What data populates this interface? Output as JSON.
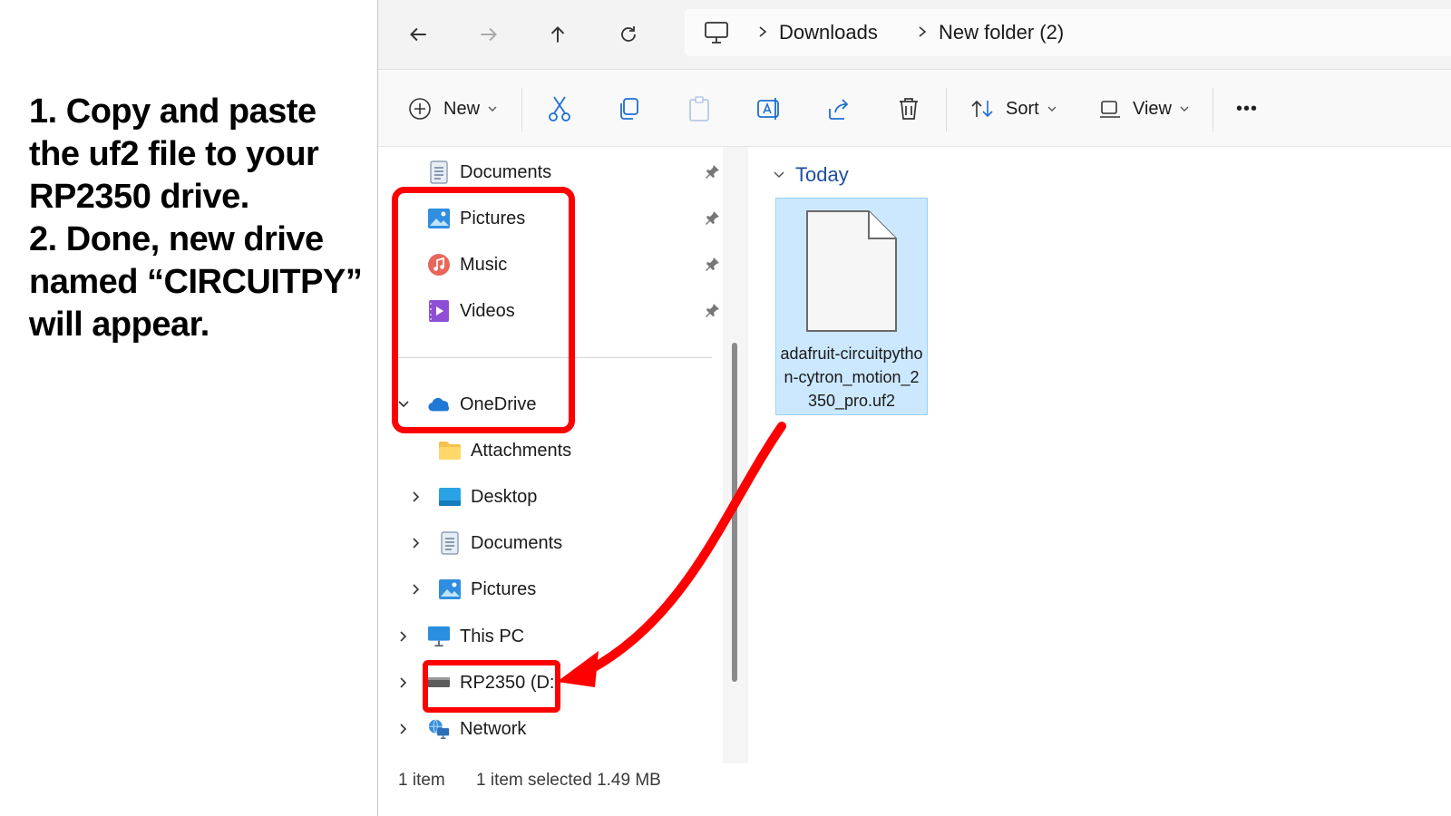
{
  "instructions": {
    "lines": [
      "1. Copy and paste",
      "the uf2 file to your",
      "RP2350 drive.",
      "2. Done, new drive",
      "named “CIRCUITPY”",
      "will appear."
    ]
  },
  "breadcrumb": {
    "items": [
      "Downloads",
      "New folder (2)"
    ]
  },
  "toolbar": {
    "new_label": "New",
    "sort_label": "Sort",
    "view_label": "View",
    "more_label": "•••"
  },
  "sidebar": {
    "quick_access": [
      {
        "label": "Documents",
        "icon": "documents-icon"
      },
      {
        "label": "Pictures",
        "icon": "pictures-icon"
      },
      {
        "label": "Music",
        "icon": "music-icon"
      },
      {
        "label": "Videos",
        "icon": "videos-icon"
      }
    ],
    "onedrive": {
      "label": "OneDrive",
      "children": [
        "Attachments",
        "Desktop",
        "Documents",
        "Pictures"
      ]
    },
    "this_pc": "This PC",
    "drive": "RP2350 (D:)",
    "network": "Network"
  },
  "content": {
    "group_label": "Today",
    "file_name": "adafruit-circuitpython-cytron_motion_2350_pro.uf2"
  },
  "status": {
    "count": "1 item",
    "selection": "1 item selected  1.49 MB"
  },
  "colors": {
    "highlight": "#ff0000",
    "selection": "#cce8ff"
  }
}
